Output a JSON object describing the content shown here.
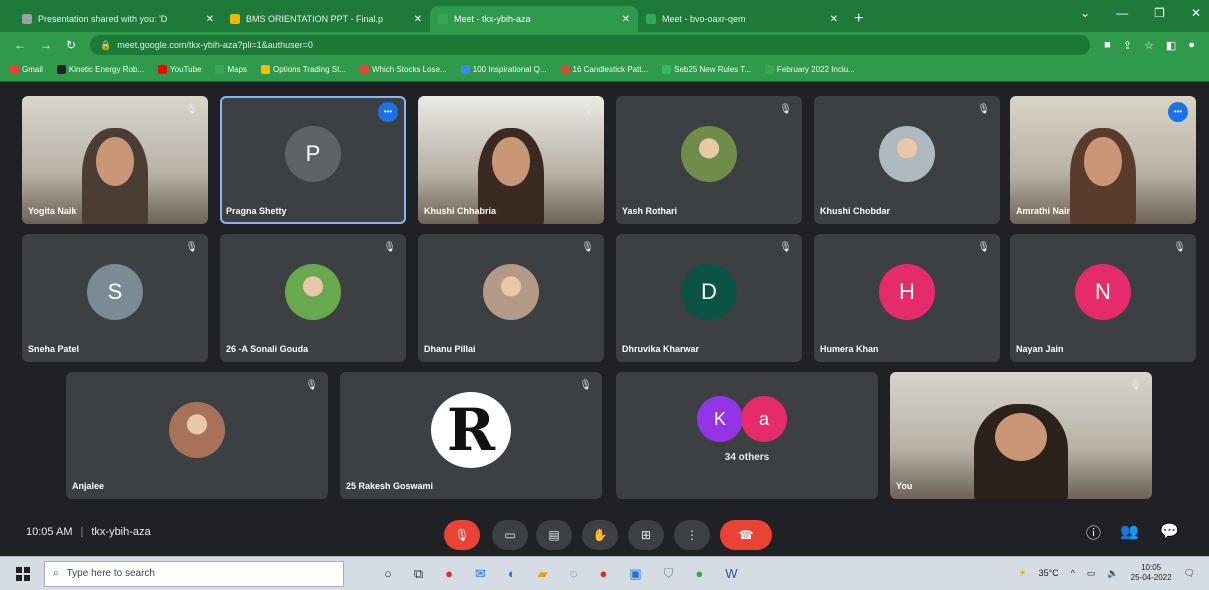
{
  "browser": {
    "tabs": [
      {
        "title": "Presentation shared with you: 'D",
        "color": "#9aa0a6"
      },
      {
        "title": "BMS ORIENTATION PPT - Final.p",
        "color": "#f4b400"
      },
      {
        "title": "Meet - tkx-ybih-aza",
        "color": "#34a853"
      },
      {
        "title": "Meet - bvo-oaxr-qem",
        "color": "#34a853"
      }
    ],
    "new_tab": "+",
    "url": "meet.google.com/tkx-ybih-aza?pli=1&authuser=0",
    "bookmarks": [
      {
        "label": "Gmail",
        "color": "#ea4335"
      },
      {
        "label": "Kinetic Energy Rob...",
        "color": "#222"
      },
      {
        "label": "YouTube",
        "color": "#ff0000"
      },
      {
        "label": "Maps",
        "color": "#34a853"
      },
      {
        "label": "Options Trading St...",
        "color": "#fbbc04"
      },
      {
        "label": "Which Stocks Lose...",
        "color": "#ea4335"
      },
      {
        "label": "100 Inspirational Q...",
        "color": "#4285f4"
      },
      {
        "label": "16 Candlestick Patt...",
        "color": "#ea4335"
      },
      {
        "label": "Seb25 New Rules T...",
        "color": "#3b6"
      },
      {
        "label": "February 2022 Inclu...",
        "color": "#34a853"
      }
    ]
  },
  "participants": [
    {
      "name": "Yogita Naik",
      "kind": "video",
      "palette": [
        "#d9d6cc",
        "#4a3d34"
      ]
    },
    {
      "name": "Pragna Shetty",
      "kind": "letter",
      "letter": "P",
      "color": "#5f6368",
      "speaking": true
    },
    {
      "name": "Khushi Chhabria",
      "kind": "video",
      "palette": [
        "#ebe9e4",
        "#3b2a22"
      ]
    },
    {
      "name": "Yash Rothari",
      "kind": "photo",
      "color": "#6f8c4b"
    },
    {
      "name": "Khushi Chobdar",
      "kind": "photo",
      "color": "#aeb8bf"
    },
    {
      "name": "Amrathi Nair",
      "kind": "video",
      "palette": [
        "#d8d4c4",
        "#5a3c2c"
      ],
      "speaking": true
    },
    {
      "name": "Sneha Patel",
      "kind": "letter",
      "letter": "S",
      "color": "#7b8b93"
    },
    {
      "name": "26 -A Sonali Gouda",
      "kind": "photo",
      "color": "#6aa84f"
    },
    {
      "name": "Dhanu Pillai",
      "kind": "photo",
      "color": "#b39a86"
    },
    {
      "name": "Dhruvika Kharwar",
      "kind": "letter",
      "letter": "D",
      "color": "#0b5345"
    },
    {
      "name": "Humera Khan",
      "kind": "letter",
      "letter": "H",
      "color": "#e52b6a"
    },
    {
      "name": "Nayan Jain",
      "kind": "letter",
      "letter": "N",
      "color": "#e52b6a"
    },
    {
      "name": "Anjalee",
      "kind": "photo",
      "color": "#a8715a"
    },
    {
      "name": "25 Rakesh Goswami",
      "kind": "logo",
      "letter": "R"
    },
    {
      "name": "34 others",
      "kind": "others",
      "letters": [
        {
          "l": "K",
          "c": "#9334e6"
        },
        {
          "l": "a",
          "c": "#e52b6a"
        }
      ]
    },
    {
      "name": "You",
      "kind": "video",
      "palette": [
        "#d7d5cb",
        "#2d211b"
      ]
    }
  ],
  "meeting": {
    "time": "10:05 AM",
    "code": "tkx-ybih-aza"
  },
  "taskbar": {
    "search_placeholder": "Type here to search",
    "temperature": "35°C",
    "clock_time": "10:05",
    "clock_date": "25-04-2022"
  }
}
